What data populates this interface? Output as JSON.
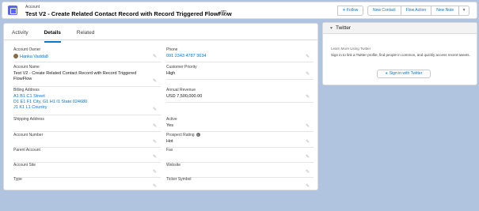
{
  "header": {
    "record_type": "Account",
    "title": "Test V2 - Create Related Contact Record with Record Triggered FlowFlow",
    "hierarchy_icon_label": "A",
    "buttons": {
      "follow": "Follow",
      "new_contact": "New Contact",
      "flow_action": "Flow Action",
      "new_note": "New Note"
    }
  },
  "tabs": [
    "Activity",
    "Details",
    "Related"
  ],
  "active_tab": "Details",
  "fields": {
    "account_owner": {
      "label": "Account Owner",
      "value": "Hanka Vadda8"
    },
    "account_name": {
      "label": "Account Name",
      "value": "Test V2 - Create Related Contact Record with Record Triggered FlowFlow"
    },
    "billing_address": {
      "label": "Billing Address",
      "line1": "A1 B1 C1 Street",
      "line2": "D1 E1 F1 City, G1 H1 I1 State 024680",
      "line3": "J1 K1 L1 Country"
    },
    "shipping_address": {
      "label": "Shipping Address",
      "value": ""
    },
    "account_number": {
      "label": "Account Number",
      "value": ""
    },
    "parent_account": {
      "label": "Parent Account",
      "value": ""
    },
    "account_site": {
      "label": "Account Site",
      "value": ""
    },
    "type": {
      "label": "Type",
      "value": ""
    },
    "phone": {
      "label": "Phone",
      "value": "091 2343 4787 3634"
    },
    "customer_priority": {
      "label": "Customer Priority",
      "value": "High"
    },
    "annual_revenue": {
      "label": "Annual Revenue",
      "value": "USD 7,500,000.00"
    },
    "active": {
      "label": "Active",
      "value": "Yes"
    },
    "prospect_rating": {
      "label": "Prospect Rating",
      "value": "Hot"
    },
    "fax": {
      "label": "Fax",
      "value": ""
    },
    "website": {
      "label": "Website",
      "value": ""
    },
    "ticker_symbol": {
      "label": "Ticker Symbol",
      "value": ""
    }
  },
  "twitter": {
    "title": "Twitter",
    "learn_more": "Learn More Using Twitter",
    "description": "Sign in to link a Twitter profile, find people in common, and quickly access recent tweets.",
    "sign_in_label": "Sign in with Twitter"
  },
  "colors": {
    "background": "#b0c4df",
    "brand": "#0176d3",
    "app_icon": "#5867e8"
  }
}
